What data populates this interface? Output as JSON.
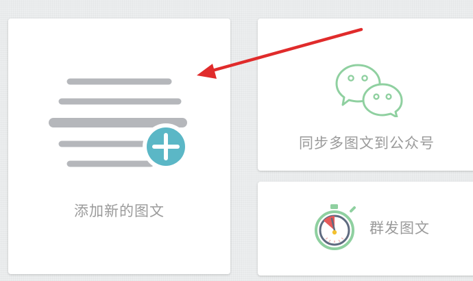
{
  "cards": {
    "add_new": {
      "label": "添加新的图文"
    },
    "sync": {
      "label": "同步多图文到公众号"
    },
    "mass_send": {
      "label": "群发图文"
    }
  },
  "colors": {
    "line_gray": "#b5b7bb",
    "plus_teal": "#5bb7c6",
    "wechat_green": "#8fd0a0",
    "arrow_red": "#e02b2b",
    "label_gray": "#9a9a9a"
  },
  "icons": {
    "add_card": "article-list-plus-icon",
    "sync_card": "wechat-icon",
    "mass_card": "stopwatch-icon",
    "annotation": "red-arrow-icon"
  }
}
